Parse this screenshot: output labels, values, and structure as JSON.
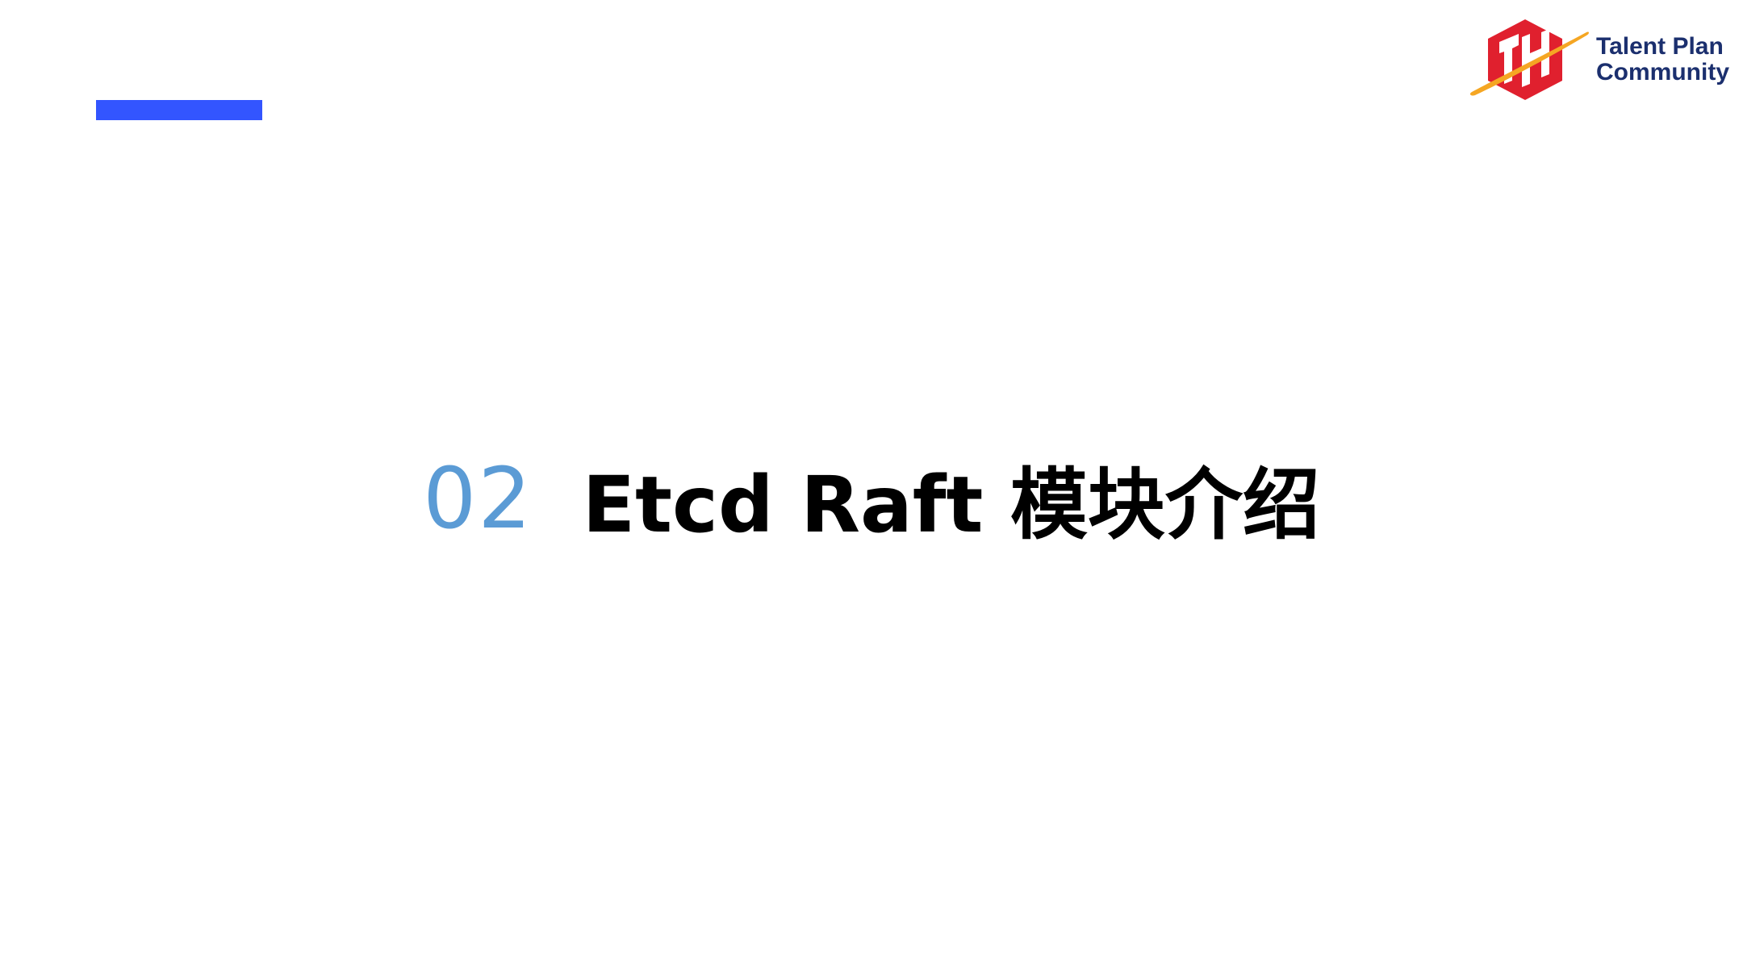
{
  "logo": {
    "line1": "Talent Plan",
    "line2": "Community",
    "colors": {
      "hexagon": "#e0202e",
      "ring": "#f5a623",
      "text": "#1b2f6e"
    }
  },
  "accent": {
    "color": "#3355ff"
  },
  "slide": {
    "section_number": "02",
    "section_title": "Etcd Raft 模块介绍",
    "number_color": "#5b9bd5",
    "title_color": "#000000"
  }
}
